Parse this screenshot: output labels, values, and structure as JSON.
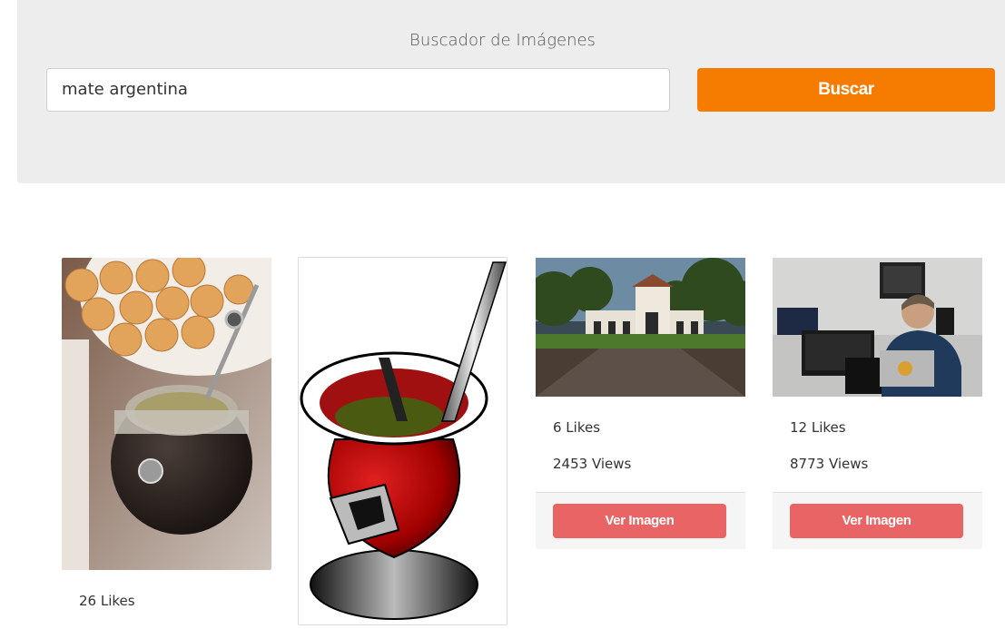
{
  "search": {
    "title": "Buscador de Imágenes",
    "query": "mate argentina",
    "button_label": "Buscar"
  },
  "colors": {
    "panel_bg": "#ededed",
    "search_button": "#f57c00",
    "view_button": "#e96565"
  },
  "results": [
    {
      "likes": "26 Likes",
      "image": "mate gourd with yerba and crackers"
    },
    {
      "image": "red mate gourd illustration"
    },
    {
      "likes": "6 Likes",
      "views": "2453 Views",
      "button_label": "Ver Imagen",
      "image": "colonial building with garden"
    },
    {
      "likes": "12 Likes",
      "views": "8773 Views",
      "button_label": "Ver Imagen",
      "image": "man working at computer"
    }
  ]
}
